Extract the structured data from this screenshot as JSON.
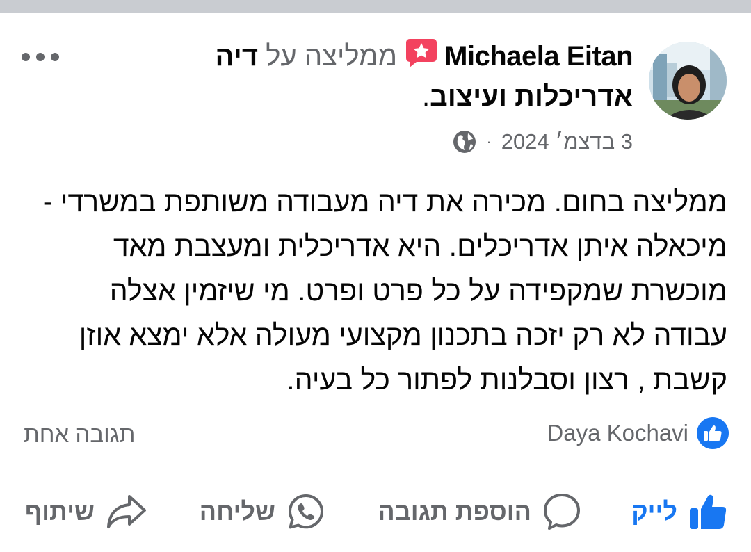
{
  "post": {
    "author": "Michaela Eitan",
    "recommends_text": "ממליצה על",
    "page_name": "דיה אדריכלות ועיצוב",
    "period": ".",
    "date": "3 בדצמ׳ 2024",
    "separator": "·",
    "privacy_icon": "globe-icon",
    "body": "ממליצה בחום. מכירה את דיה מעבודה משותפת במשרדי - מיכאלה איתן אדריכלים. היא אדריכלית ומעצבת מאד מוכשרת שמקפידה על כל פרט ופרט. מי שיזמין אצלה עבודה לא רק יזכה בתכנון מקצועי מעולה אלא ימצא אוזן קשבת , רצון וסבלנות לפתור כל בעיה."
  },
  "reactions": {
    "icon": "like-badge-icon",
    "names": "Daya Kochavi",
    "comments": "תגובה אחת"
  },
  "actions": {
    "like": "לייק",
    "comment": "הוספת תגובה",
    "send": "שליחה",
    "share": "שיתוף"
  },
  "colors": {
    "accent": "#1877f2",
    "secondary_text": "#65676b",
    "recommend_badge": "#f3425f",
    "top_strip": "#c9ccd1"
  }
}
